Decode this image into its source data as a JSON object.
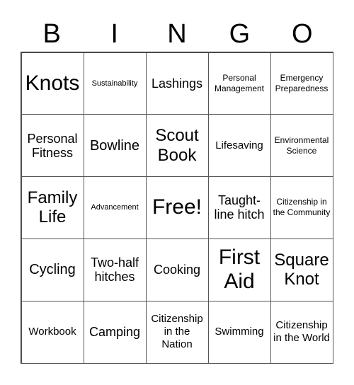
{
  "header": [
    "B",
    "I",
    "N",
    "G",
    "O"
  ],
  "cells": [
    {
      "text": "Knots",
      "size": "s-xl"
    },
    {
      "text": "Sustainability",
      "size": "s-xxs"
    },
    {
      "text": "Lashings",
      "size": "s-m"
    },
    {
      "text": "Personal Management",
      "size": "s-xs"
    },
    {
      "text": "Emergency Preparedness",
      "size": "s-xs"
    },
    {
      "text": "Personal Fitness",
      "size": "s-m"
    },
    {
      "text": "Bowline",
      "size": "s-ml"
    },
    {
      "text": "Scout Book",
      "size": "s-l"
    },
    {
      "text": "Lifesaving",
      "size": "s-s"
    },
    {
      "text": "Environmental Science",
      "size": "s-xs"
    },
    {
      "text": "Family Life",
      "size": "s-l"
    },
    {
      "text": "Advancement",
      "size": "s-xxs"
    },
    {
      "text": "Free!",
      "size": "s-xl"
    },
    {
      "text": "Taught-line hitch",
      "size": "s-m"
    },
    {
      "text": "Citizenship in the Community",
      "size": "s-xs"
    },
    {
      "text": "Cycling",
      "size": "s-ml"
    },
    {
      "text": "Two-half hitches",
      "size": "s-m"
    },
    {
      "text": "Cooking",
      "size": "s-m"
    },
    {
      "text": "First Aid",
      "size": "s-xl"
    },
    {
      "text": "Square Knot",
      "size": "s-l"
    },
    {
      "text": "Workbook",
      "size": "s-s"
    },
    {
      "text": "Camping",
      "size": "s-m"
    },
    {
      "text": "Citizenship in the Nation",
      "size": "s-s"
    },
    {
      "text": "Swimming",
      "size": "s-s"
    },
    {
      "text": "Citizenship in the World",
      "size": "s-s"
    }
  ]
}
